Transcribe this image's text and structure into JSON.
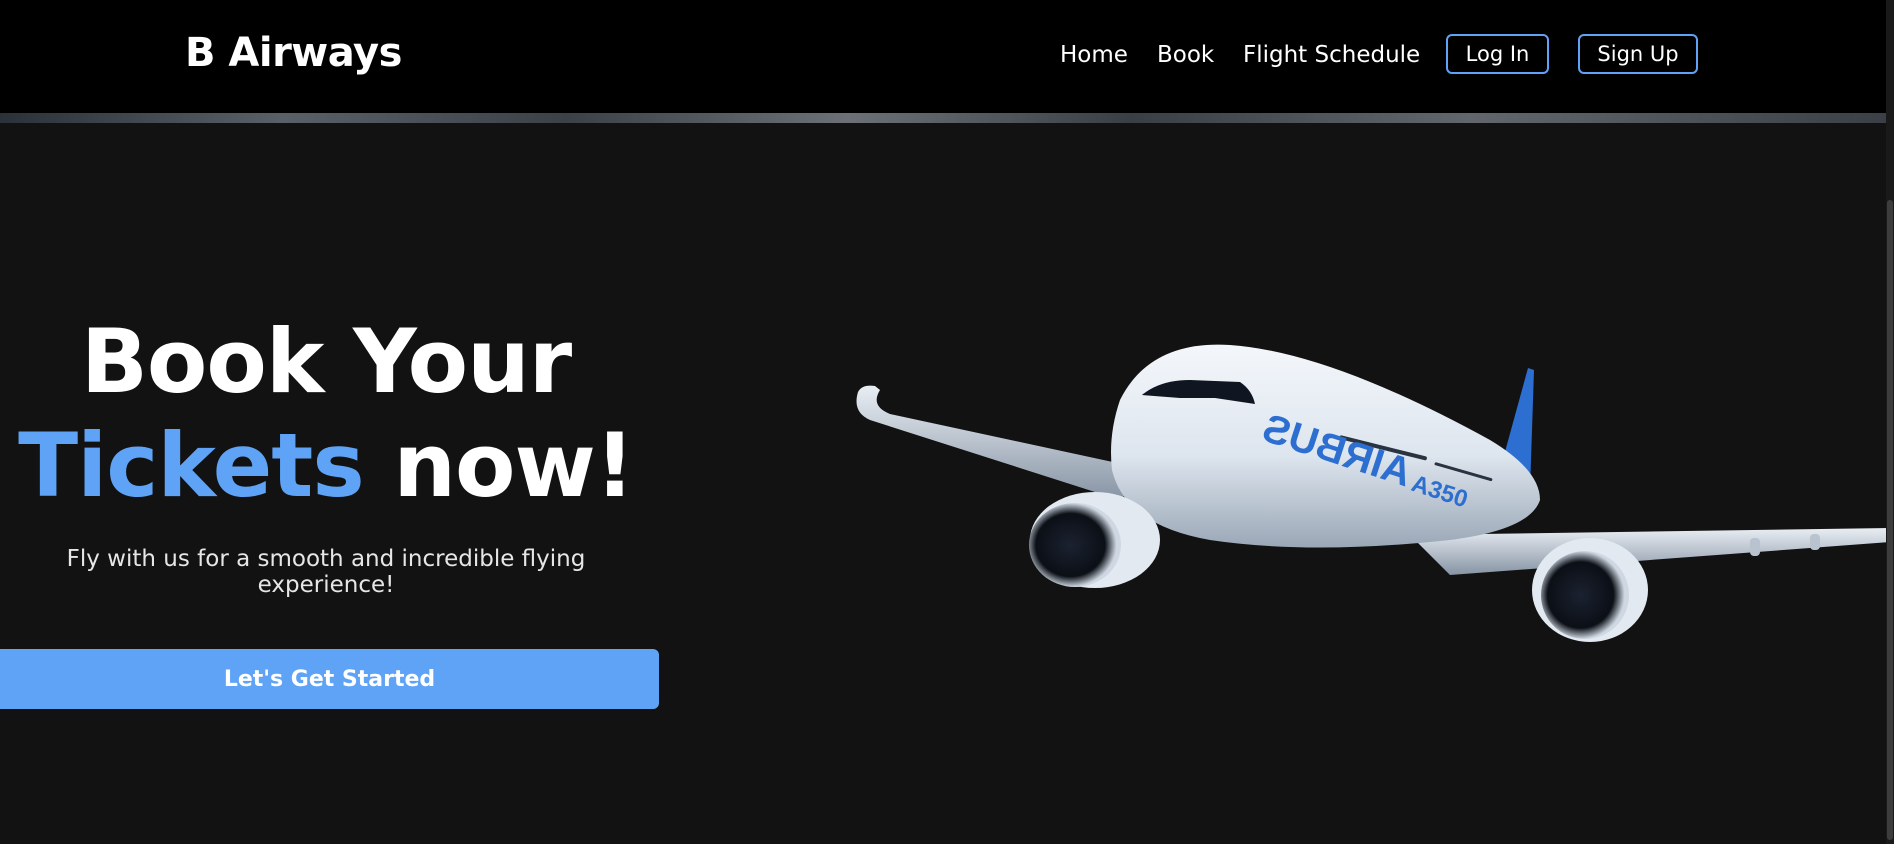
{
  "brand": "B Airways",
  "nav": {
    "home": "Home",
    "book": "Book",
    "schedule": "Flight Schedule",
    "login": "Log In",
    "signup": "Sign Up"
  },
  "hero": {
    "line1": "Book Your",
    "line2_accent": "Tickets",
    "line2_rest": "now!",
    "subtitle": "Fly with us for a smooth and incredible flying experience!",
    "cta": "Let's Get Started"
  },
  "plane": {
    "livery_text": "AIRBUS",
    "model_text": "A350"
  },
  "colors": {
    "accent": "#5fa3f6",
    "background": "#121212",
    "navbar": "#000000"
  }
}
